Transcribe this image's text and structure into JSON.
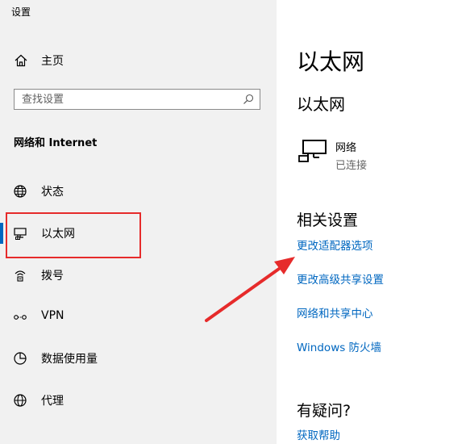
{
  "window": {
    "title": "设置"
  },
  "sidebar": {
    "home_label": "主页",
    "search_placeholder": "查找设置",
    "section_title": "网络和 Internet",
    "items": [
      {
        "label": "状态",
        "icon": "globe-status-icon"
      },
      {
        "label": "以太网",
        "icon": "ethernet-icon",
        "selected": true
      },
      {
        "label": "拨号",
        "icon": "dialup-icon"
      },
      {
        "label": "VPN",
        "icon": "vpn-icon"
      },
      {
        "label": "数据使用量",
        "icon": "data-usage-icon"
      },
      {
        "label": "代理",
        "icon": "proxy-globe-icon"
      }
    ]
  },
  "main": {
    "title": "以太网",
    "subtitle": "以太网",
    "network": {
      "name": "网络",
      "status": "已连接"
    },
    "related_title": "相关设置",
    "related_links": [
      "更改适配器选项",
      "更改高级共享设置",
      "网络和共享中心",
      "Windows 防火墙"
    ],
    "faq_title": "有疑问?",
    "faq_link": "获取帮助"
  },
  "colors": {
    "accent": "#0067c0",
    "annotation": "#e62b2b",
    "sidebar_bg": "#f1f1f1"
  }
}
